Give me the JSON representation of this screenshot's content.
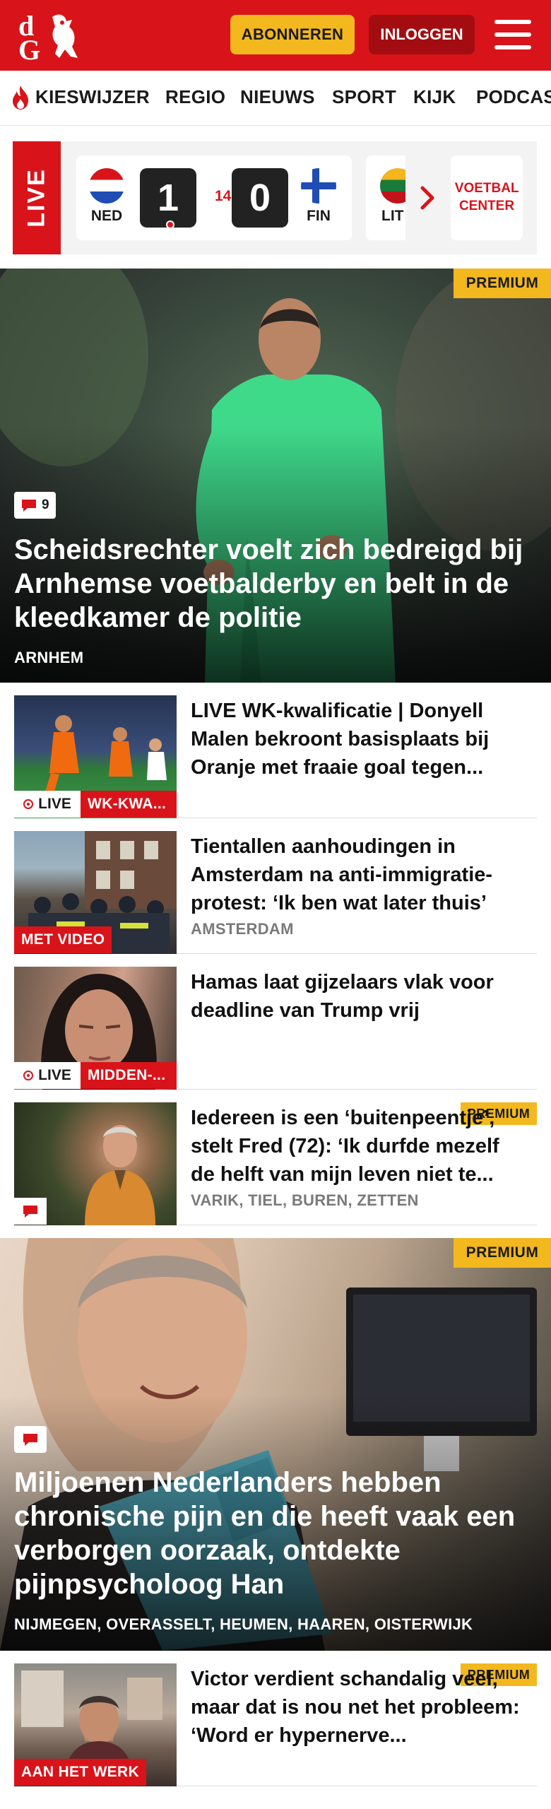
{
  "header": {
    "logo_text": "dG",
    "subscribe_label": "ABONNEREN",
    "login_label": "INLOGGEN",
    "brand_color": "#d8141a",
    "accent_color": "#f2b81e"
  },
  "nav": {
    "items": [
      "KIESWIJZER",
      "REGIO",
      "NIEUWS",
      "SPORT",
      "KIJK",
      "PODCAS"
    ]
  },
  "live_scores": {
    "tag": "LIVE",
    "match": {
      "home_code": "NED",
      "home_score": "1",
      "minute": "14'",
      "away_score": "0",
      "away_code": "FIN"
    },
    "next_match_code": "LIT",
    "voetbal_center_label": "VOETBAL CENTER"
  },
  "articles": [
    {
      "premium": "PREMIUM",
      "comments": "9",
      "title": "Scheidsrechter voelt zich bedreigd bij Arnhemse voetbalderby en belt in de kleedkamer de politie",
      "location": "ARNHEM"
    },
    {
      "live": "LIVE",
      "label": "WK-KWA...",
      "title": "LIVE WK-kwalificatie | Donyell Malen bekroont basisplaats bij Oranje met fraaie goal tegen..."
    },
    {
      "label": "MET VIDEO",
      "title": "Tientallen aanhoudingen in Amsterdam na anti-immigratie-protest: ‘Ik ben wat later thuis’",
      "location": "AMSTERDAM"
    },
    {
      "live": "LIVE",
      "label": "MIDDEN-...",
      "title": "Hamas laat gijzelaars vlak voor deadline van Trump vrij"
    },
    {
      "premium": "PREMIUM",
      "title": "Iedereen is een ‘buitenpeentje’, stelt Fred (72): ‘Ik durfde mezelf de helft van mijn leven niet te...",
      "location": "VARIK, TIEL, BUREN, ZETTEN"
    },
    {
      "premium": "PREMIUM",
      "title": "Miljoenen Nederlanders hebben chronische pijn en die heeft vaak een verborgen oorzaak, ontdekte pijnpsycholoog Han",
      "location": "NIJMEGEN, OVERASSELT, HEUMEN, HAAREN, OISTERWIJK"
    },
    {
      "premium": "PREMIUM",
      "label": "AAN HET WERK",
      "title": "Victor verdient schandalig veel, maar dat is nou net het probleem: ‘Word er hypernerve..."
    }
  ]
}
